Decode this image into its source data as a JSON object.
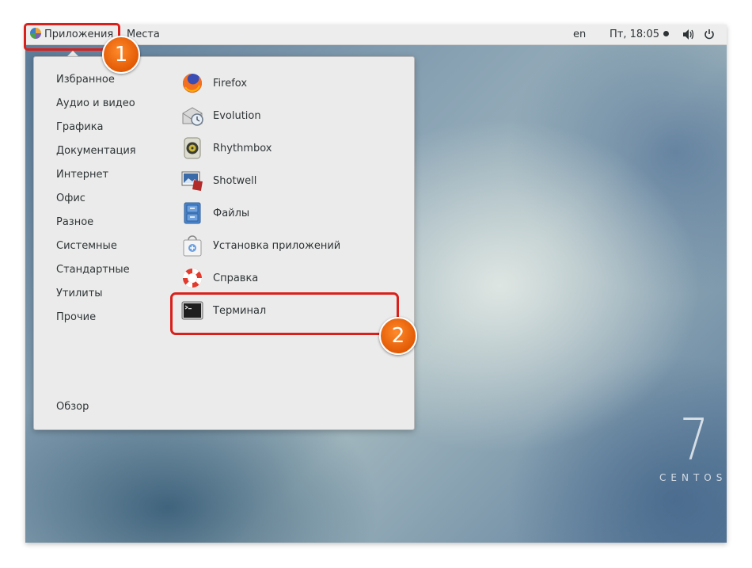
{
  "topbar": {
    "apps_label": "Приложения",
    "places_label": "Места",
    "lang": "en",
    "clock": "Пт, 18:05",
    "volume_icon": "speaker-icon",
    "power_icon": "power-icon"
  },
  "menu": {
    "categories": [
      "Избранное",
      "Аудио и видео",
      "Графика",
      "Документация",
      "Интернет",
      "Офис",
      "Разное",
      "Системные",
      "Стандартные",
      "Утилиты",
      "Прочие"
    ],
    "overview": "Обзор",
    "apps": [
      {
        "label": "Firefox",
        "icon": "firefox-icon"
      },
      {
        "label": "Evolution",
        "icon": "evolution-icon"
      },
      {
        "label": "Rhythmbox",
        "icon": "rhythmbox-icon"
      },
      {
        "label": "Shotwell",
        "icon": "shotwell-icon"
      },
      {
        "label": "Файлы",
        "icon": "files-icon"
      },
      {
        "label": "Установка приложений",
        "icon": "software-install-icon"
      },
      {
        "label": "Справка",
        "icon": "help-icon"
      },
      {
        "label": "Терминал",
        "icon": "terminal-icon"
      }
    ]
  },
  "annotations": {
    "step1": "1",
    "step2": "2"
  },
  "brand": {
    "version": "7",
    "name": "CENTOS"
  },
  "colors": {
    "highlight": "#d9201b",
    "badge": "#e8620a"
  }
}
